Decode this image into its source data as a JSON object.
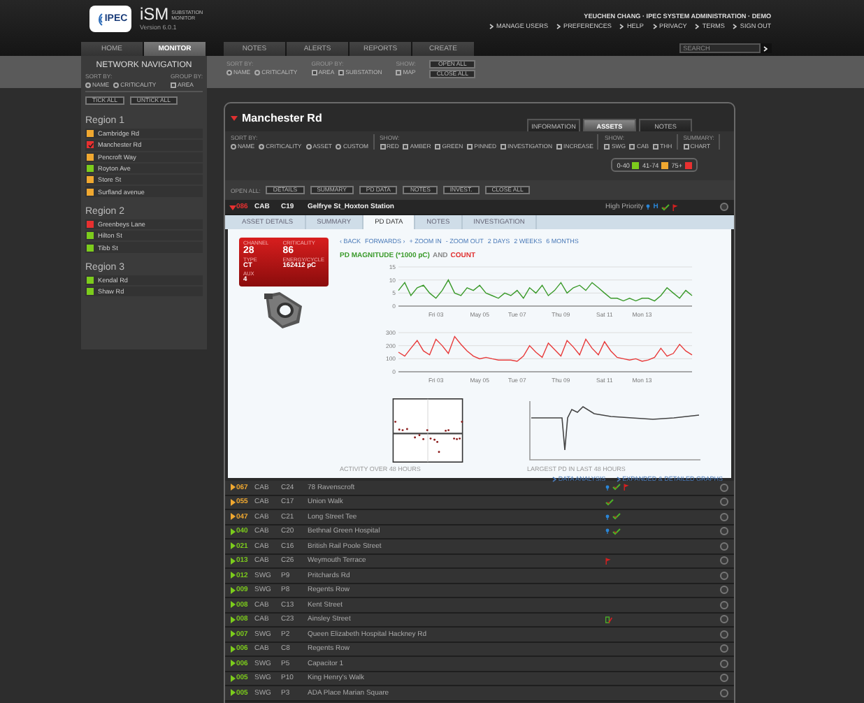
{
  "header": {
    "logo_text": "IPEC",
    "app_name": "iSM",
    "app_subtitle": "SUBSTATION MONITOR",
    "version": "Version 6.0.1",
    "user": "YEUCHEN CHANG · IPEC SYSTEM ADMINISTRATION · DEMO",
    "links": [
      "MANAGE USERS",
      "PREFERENCES",
      "HELP",
      "PRIVACY",
      "TERMS",
      "SIGN OUT"
    ],
    "search": {
      "placeholder": "SEARCH"
    }
  },
  "nav": {
    "primary": [
      {
        "label": "HOME",
        "selected": false
      },
      {
        "label": "MONITOR",
        "selected": true
      }
    ],
    "secondary": [
      {
        "label": "NOTES",
        "selected": false
      },
      {
        "label": "ALERTS",
        "selected": false
      },
      {
        "label": "REPORTS",
        "selected": false
      },
      {
        "label": "CREATE",
        "selected": false
      }
    ]
  },
  "toolbar": {
    "groups": [
      {
        "label": "SORT BY:",
        "kind": "radio",
        "options": [
          {
            "label": "NAME",
            "selected": true
          },
          {
            "label": "CRITICALITY",
            "selected": false
          }
        ]
      },
      {
        "label": "GROUP BY:",
        "kind": "checkbox",
        "options": [
          {
            "label": "AREA",
            "checked": true
          },
          {
            "label": "SUBSTATION",
            "checked": true
          }
        ]
      },
      {
        "label": "SHOW:",
        "kind": "checkbox",
        "options": [
          {
            "label": "MAP",
            "checked": false
          }
        ]
      }
    ],
    "buttons": [
      "OPEN ALL",
      "CLOSE ALL"
    ]
  },
  "sidebar": {
    "title": "NETWORK NAVIGATION",
    "sort_label": "SORT BY:",
    "sort_options": [
      {
        "label": "NAME",
        "selected": true
      },
      {
        "label": "CRITICALITY",
        "selected": false
      }
    ],
    "group_label": "GROUP BY:",
    "group_options": [
      {
        "label": "AREA",
        "checked": true
      }
    ],
    "buttons": [
      "TICK ALL",
      "UNTICK ALL"
    ],
    "regions": [
      {
        "name": "Region 1",
        "items": [
          {
            "name": "Cambridge Rd",
            "color": "#f0a830",
            "selected": false
          },
          {
            "name": "Manchester Rd",
            "color": "#e83030",
            "selected": true
          },
          {
            "name": "Pencroft Way",
            "color": "#f0a830",
            "selected": false
          },
          {
            "name": "Royton Ave",
            "color": "#7ccc1c",
            "selected": false
          },
          {
            "name": "Store St",
            "color": "#f0a830",
            "selected": false
          },
          {
            "name": "Surfland avenue",
            "color": "#f0a830",
            "selected": false
          }
        ]
      },
      {
        "name": "Region 2",
        "items": [
          {
            "name": "Greenbeys Lane",
            "color": "#e83030",
            "selected": false
          },
          {
            "name": "Hilton St",
            "color": "#7ccc1c",
            "selected": false
          },
          {
            "name": "Tibb St",
            "color": "#7ccc1c",
            "selected": false
          }
        ]
      },
      {
        "name": "Region 3",
        "items": [
          {
            "name": "Kendal Rd",
            "color": "#7ccc1c",
            "selected": false
          },
          {
            "name": "Shaw Rd",
            "color": "#7ccc1c",
            "selected": false
          }
        ]
      }
    ]
  },
  "panel": {
    "title": "Manchester Rd",
    "expanded": true,
    "tabs": [
      {
        "label": "INFORMATION",
        "selected": false
      },
      {
        "label": "ASSETS",
        "selected": true
      },
      {
        "label": "NOTES",
        "selected": false
      }
    ],
    "filters": [
      {
        "label": "SORT BY:",
        "kind": "radio",
        "options": [
          {
            "label": "NAME",
            "selected": false
          },
          {
            "label": "CRITICALITY",
            "selected": true
          },
          {
            "label": "ASSET",
            "selected": false
          },
          {
            "label": "CUSTOM",
            "selected": false
          }
        ]
      },
      {
        "label": "SHOW:",
        "kind": "checkbox",
        "options": [
          {
            "label": "RED",
            "checked": true
          },
          {
            "label": "AMBER",
            "checked": true
          },
          {
            "label": "GREEN",
            "checked": true
          },
          {
            "label": "PINNED",
            "checked": false
          },
          {
            "label": "INVESTIGATION",
            "checked": false
          },
          {
            "label": "INCREASE",
            "checked": false
          }
        ]
      },
      {
        "label": "SHOW:",
        "kind": "checkbox",
        "options": [
          {
            "label": "SWG",
            "checked": true
          },
          {
            "label": "CAB",
            "checked": true
          },
          {
            "label": "THH",
            "checked": true
          }
        ]
      },
      {
        "label": "SUMMARY:",
        "kind": "checkbox",
        "options": [
          {
            "label": "CHART",
            "checked": false
          }
        ]
      }
    ],
    "legend": [
      {
        "label": "0-40",
        "color": "#7ccc1c"
      },
      {
        "label": "41-74",
        "color": "#f0a830"
      },
      {
        "label": "75+",
        "color": "#e83030"
      }
    ],
    "open_all": {
      "label": "OPEN ALL:",
      "buttons": [
        "DETAILS",
        "SUMMARY",
        "PD DATA",
        "NOTES",
        "INVEST.",
        "CLOSE ALL"
      ]
    },
    "assets": [
      {
        "score": "086",
        "type": "CAB",
        "code": "C19",
        "name": "Gelfrye St_Hoxton Station",
        "color": "#e83030",
        "expanded": true,
        "priority": "High Priority",
        "badge": "H",
        "pinned": true,
        "reviewed": true,
        "flagged": true,
        "increase": false
      },
      {
        "score": "067",
        "type": "CAB",
        "code": "C24",
        "name": "78 Ravenscroft",
        "color": "#f0a830",
        "expanded": false,
        "pinned": true,
        "reviewed": true,
        "flagged": true,
        "increase": false
      },
      {
        "score": "055",
        "type": "CAB",
        "code": "C17",
        "name": "Union Walk",
        "color": "#f0a830",
        "expanded": false,
        "pinned": false,
        "reviewed": true,
        "flagged": false,
        "increase": false
      },
      {
        "score": "047",
        "type": "CAB",
        "code": "C21",
        "name": "Long Street Tee",
        "color": "#f0a830",
        "expanded": false,
        "pinned": true,
        "reviewed": true,
        "flagged": false,
        "increase": false
      },
      {
        "score": "040",
        "type": "CAB",
        "code": "C20",
        "name": "Bethnal Green Hospital",
        "color": "#7ccc1c",
        "expanded": false,
        "pinned": true,
        "reviewed": true,
        "flagged": false,
        "increase": false
      },
      {
        "score": "021",
        "type": "CAB",
        "code": "C16",
        "name": "British Rail Poole Street",
        "color": "#7ccc1c",
        "expanded": false,
        "pinned": false,
        "reviewed": false,
        "flagged": false,
        "increase": false
      },
      {
        "score": "013",
        "type": "CAB",
        "code": "C26",
        "name": "Weymouth Terrace",
        "color": "#7ccc1c",
        "expanded": false,
        "pinned": false,
        "reviewed": false,
        "flagged": true,
        "increase": false
      },
      {
        "score": "012",
        "type": "SWG",
        "code": "P9",
        "name": "Pritchards Rd",
        "color": "#7ccc1c",
        "expanded": false,
        "pinned": false,
        "reviewed": false,
        "flagged": false,
        "increase": false
      },
      {
        "score": "009",
        "type": "SWG",
        "code": "P8",
        "name": "Regents Row",
        "color": "#7ccc1c",
        "expanded": false,
        "pinned": false,
        "reviewed": false,
        "flagged": false,
        "increase": false
      },
      {
        "score": "008",
        "type": "CAB",
        "code": "C13",
        "name": "Kent Street",
        "color": "#7ccc1c",
        "expanded": false,
        "pinned": false,
        "reviewed": false,
        "flagged": false,
        "increase": false
      },
      {
        "score": "008",
        "type": "CAB",
        "code": "C23",
        "name": "Ainsley Street",
        "color": "#7ccc1c",
        "expanded": false,
        "pinned": false,
        "reviewed": false,
        "flagged": false,
        "increase": true
      },
      {
        "score": "007",
        "type": "SWG",
        "code": "P2",
        "name": "Queen Elizabeth Hospital Hackney Rd",
        "color": "#7ccc1c",
        "expanded": false,
        "pinned": false,
        "reviewed": false,
        "flagged": false,
        "increase": false
      },
      {
        "score": "006",
        "type": "CAB",
        "code": "C8",
        "name": "Regents Row",
        "color": "#7ccc1c",
        "expanded": false,
        "pinned": false,
        "reviewed": false,
        "flagged": false,
        "increase": false
      },
      {
        "score": "006",
        "type": "SWG",
        "code": "P5",
        "name": "Capacitor 1",
        "color": "#7ccc1c",
        "expanded": false,
        "pinned": false,
        "reviewed": false,
        "flagged": false,
        "increase": false
      },
      {
        "score": "005",
        "type": "SWG",
        "code": "P10",
        "name": "King Henry's Walk",
        "color": "#7ccc1c",
        "expanded": false,
        "pinned": false,
        "reviewed": false,
        "flagged": false,
        "increase": false
      },
      {
        "score": "005",
        "type": "SWG",
        "code": "P3",
        "name": "ADA Place Marian Square",
        "color": "#7ccc1c",
        "expanded": false,
        "pinned": false,
        "reviewed": false,
        "flagged": false,
        "increase": false
      }
    ],
    "detail": {
      "tabs": [
        {
          "label": "ASSET DETAILS",
          "selected": false
        },
        {
          "label": "SUMMARY",
          "selected": false
        },
        {
          "label": "PD DATA",
          "selected": true
        },
        {
          "label": "NOTES",
          "selected": false
        },
        {
          "label": "INVESTIGATION",
          "selected": false
        }
      ],
      "card": {
        "color": "#d81e1e",
        "fields": [
          {
            "label": "CHANNEL",
            "value": "28"
          },
          {
            "label": "CRITICALITY",
            "value": "86"
          },
          {
            "label": "TYPE",
            "value": "CT"
          },
          {
            "label": "ENERGY/CYCLE",
            "value": "162412 pC"
          },
          {
            "label": "AUX",
            "value": "4"
          }
        ]
      },
      "nav_links": [
        "‹ BACK",
        "FORWARDS ›",
        "+ ZOOM IN",
        "- ZOOM OUT",
        "2 DAYS",
        "2 WEEKS",
        "6 MONTHS"
      ],
      "chart_title": [
        {
          "text": "PD MAGNITUDE (*1000 pC)",
          "color": "#3a9a2a"
        },
        {
          "text": "AND",
          "color": "#888888"
        },
        {
          "text": "COUNT",
          "color": "#e03030"
        }
      ],
      "charts": [
        {
          "chart_data": {
            "type": "line",
            "ylim": [
              0,
              15
            ],
            "yticks": [
              0,
              5,
              10,
              15
            ],
            "categories": [
              null,
              null,
              null,
              null,
              null,
              null,
              "Fri 03",
              null,
              null,
              null,
              null,
              null,
              null,
              "May 05",
              null,
              null,
              null,
              null,
              null,
              "Tue 07",
              null,
              null,
              null,
              null,
              null,
              null,
              "Thu 09",
              null,
              null,
              null,
              null,
              null,
              null,
              "Sat 11",
              null,
              null,
              null,
              null,
              null,
              "Mon 13",
              null,
              null,
              null,
              null,
              null,
              null,
              null,
              null
            ],
            "series": [
              {
                "color": "#3a9a2a",
                "values": [
                  6,
                  9,
                  4,
                  7,
                  8,
                  5,
                  3,
                  6,
                  10,
                  5,
                  4,
                  7,
                  6,
                  8,
                  5,
                  4,
                  3,
                  5,
                  4,
                  6,
                  3,
                  7,
                  5,
                  8,
                  4,
                  6,
                  9,
                  5,
                  7,
                  8,
                  6,
                  9,
                  7,
                  5,
                  3,
                  3,
                  2,
                  3,
                  2,
                  3,
                  3,
                  2,
                  4,
                  7,
                  5,
                  3,
                  6,
                  4
                ]
              }
            ]
          }
        },
        {
          "chart_data": {
            "type": "line",
            "ylim": [
              0,
              300
            ],
            "yticks": [
              0,
              100,
              200,
              300
            ],
            "categories": [
              null,
              null,
              null,
              null,
              null,
              null,
              "Fri 03",
              null,
              null,
              null,
              null,
              null,
              null,
              "May 05",
              null,
              null,
              null,
              null,
              null,
              "Tue 07",
              null,
              null,
              null,
              null,
              null,
              null,
              "Thu 09",
              null,
              null,
              null,
              null,
              null,
              null,
              "Sat 11",
              null,
              null,
              null,
              null,
              null,
              "Mon 13",
              null,
              null,
              null,
              null,
              null,
              null,
              null,
              null
            ],
            "series": [
              {
                "color": "#e83a3a",
                "values": [
                  150,
                  120,
                  180,
                  240,
                  160,
                  130,
                  250,
                  200,
                  140,
                  270,
                  210,
                  160,
                  120,
                  100,
                  110,
                  100,
                  90,
                  90,
                  90,
                  80,
                  120,
                  200,
                  150,
                  110,
                  220,
                  170,
                  120,
                  240,
                  190,
                  130,
                  250,
                  180,
                  130,
                  230,
                  160,
                  110,
                  100,
                  90,
                  100,
                  80,
                  90,
                  110,
                  180,
                  120,
                  140,
                  210,
                  160,
                  130
                ]
              }
            ]
          }
        }
      ],
      "activity_caption": "ACTIVITY OVER 48 HOURS",
      "largest_caption": "LARGEST PD IN LAST 48 HOURS",
      "links": [
        "DATA ANALYSIS",
        "EXPANDED & DETAILED GRAPHS"
      ]
    }
  }
}
